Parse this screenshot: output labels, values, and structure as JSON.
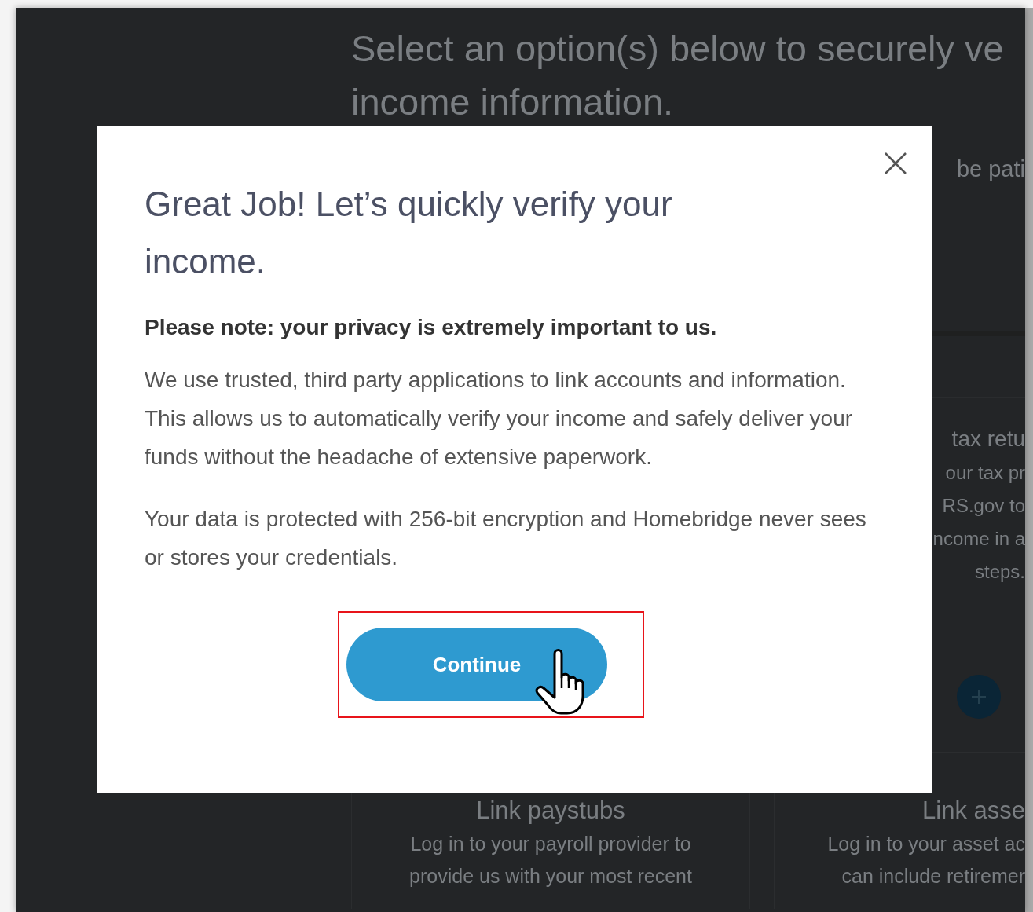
{
  "background": {
    "heading_lines": [
      "Select an option(s) below to securely ve",
      "income information."
    ],
    "note_fragment": "be pati",
    "side_card": {
      "title": "tax retu",
      "lines": [
        "our tax pr",
        "RS.gov to",
        "ncome in a",
        "steps."
      ]
    },
    "bottom_cards": [
      {
        "title": "Link paystubs",
        "lines": [
          "Log in to your payroll provider to",
          "provide us with your most recent"
        ]
      },
      {
        "title": "Link asse",
        "lines": [
          "Log in to your asset ac",
          "can include retiremer"
        ]
      }
    ]
  },
  "modal": {
    "title": "Great Job! Let’s quickly verify your income.",
    "note": "Please note: your privacy is extremely important to us.",
    "paragraphs": [
      "We use trusted, third party applications to link accounts and information. This allows us to automatically verify your income and safely deliver your funds without the headache of extensive paperwork.",
      "Your data is protected with 256-bit encryption and Homebridge never sees or stores your credentials."
    ],
    "button": "Continue"
  }
}
